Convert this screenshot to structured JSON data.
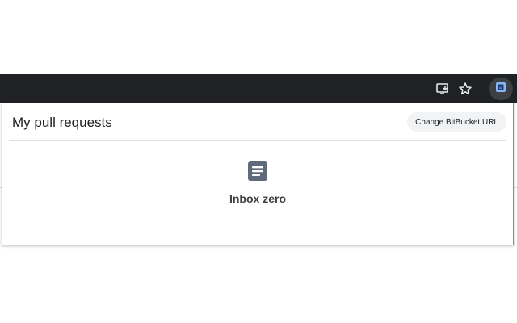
{
  "browser": {
    "toolbar_icons": [
      "install-app-icon",
      "bookmark-star-icon",
      "extension-icon"
    ]
  },
  "popup": {
    "title": "My pull requests",
    "change_url_label": "Change BitBucket URL",
    "empty_state": {
      "icon": "document-icon",
      "message": "Inbox zero"
    }
  },
  "colors": {
    "toolbar_bg": "#202124",
    "extension_accent": "#8ab4f8",
    "empty_icon": "#5f6b7a"
  }
}
